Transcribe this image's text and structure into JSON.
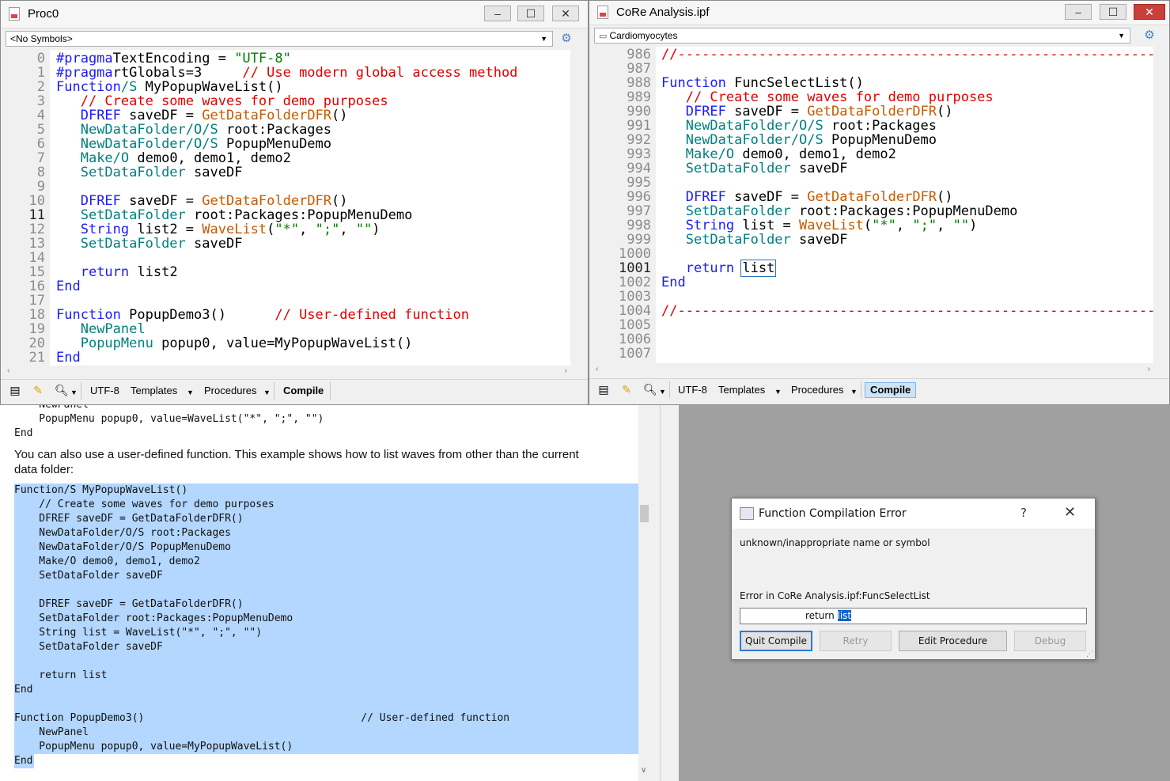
{
  "proc0": {
    "title": "Proc0",
    "symbols": "<No Symbols>",
    "lines": [
      {
        "n": "0",
        "segs": [
          [
            "kw",
            "#pragma"
          ],
          [
            "",
            "TextEncoding = "
          ],
          [
            "st",
            "\"UTF-8\""
          ]
        ]
      },
      {
        "n": "1",
        "segs": [
          [
            "kw",
            "#pragma"
          ],
          [
            "",
            "rtGlobals=3     "
          ],
          [
            "cm",
            "// Use modern global access method"
          ]
        ]
      },
      {
        "n": "2",
        "segs": [
          [
            "kw",
            "Function"
          ],
          [
            "op",
            "/S"
          ],
          [
            "",
            " MyPopupWaveList()"
          ]
        ]
      },
      {
        "n": "3",
        "segs": [
          [
            "",
            "   "
          ],
          [
            "cm",
            "// Create some waves for demo purposes"
          ]
        ]
      },
      {
        "n": "4",
        "segs": [
          [
            "",
            "   "
          ],
          [
            "kw",
            "DFREF"
          ],
          [
            "",
            " saveDF = "
          ],
          [
            "fn",
            "GetDataFolderDFR"
          ],
          [
            "",
            "()"
          ]
        ]
      },
      {
        "n": "5",
        "segs": [
          [
            "",
            "   "
          ],
          [
            "op",
            "NewDataFolder/O/S"
          ],
          [
            "",
            " root:Packages"
          ]
        ]
      },
      {
        "n": "6",
        "segs": [
          [
            "",
            "   "
          ],
          [
            "op",
            "NewDataFolder/O/S"
          ],
          [
            "",
            " PopupMenuDemo"
          ]
        ]
      },
      {
        "n": "7",
        "segs": [
          [
            "",
            "   "
          ],
          [
            "op",
            "Make/O"
          ],
          [
            "",
            " demo0, demo1, demo2"
          ]
        ]
      },
      {
        "n": "8",
        "segs": [
          [
            "",
            "   "
          ],
          [
            "op",
            "SetDataFolder"
          ],
          [
            "",
            " saveDF"
          ]
        ]
      },
      {
        "n": "9",
        "segs": []
      },
      {
        "n": "10",
        "segs": [
          [
            "",
            "   "
          ],
          [
            "kw",
            "DFREF"
          ],
          [
            "",
            " saveDF = "
          ],
          [
            "fn",
            "GetDataFolderDFR"
          ],
          [
            "",
            "()"
          ]
        ]
      },
      {
        "n": "11",
        "cur": true,
        "segs": [
          [
            "",
            "   "
          ],
          [
            "op",
            "SetDataFolder"
          ],
          [
            "",
            " root:Packages:PopupMenuDemo"
          ]
        ]
      },
      {
        "n": "12",
        "segs": [
          [
            "",
            "   "
          ],
          [
            "kw",
            "String"
          ],
          [
            "",
            " list2 = "
          ],
          [
            "fn",
            "WaveList"
          ],
          [
            "",
            "("
          ],
          [
            "st",
            "\"*\""
          ],
          [
            "",
            ", "
          ],
          [
            "st",
            "\";\""
          ],
          [
            "",
            ", "
          ],
          [
            "st",
            "\"\""
          ],
          [
            "",
            ")"
          ]
        ]
      },
      {
        "n": "13",
        "segs": [
          [
            "",
            "   "
          ],
          [
            "op",
            "SetDataFolder"
          ],
          [
            "",
            " saveDF"
          ]
        ]
      },
      {
        "n": "14",
        "segs": []
      },
      {
        "n": "15",
        "segs": [
          [
            "",
            "   "
          ],
          [
            "kw",
            "return"
          ],
          [
            "",
            " list2"
          ]
        ]
      },
      {
        "n": "16",
        "segs": [
          [
            "kw",
            "End"
          ]
        ]
      },
      {
        "n": "17",
        "segs": []
      },
      {
        "n": "18",
        "segs": [
          [
            "kw",
            "Function"
          ],
          [
            "",
            " PopupDemo3()      "
          ],
          [
            "cm",
            "// User-defined function"
          ]
        ]
      },
      {
        "n": "19",
        "segs": [
          [
            "",
            "   "
          ],
          [
            "op",
            "NewPanel"
          ]
        ]
      },
      {
        "n": "20",
        "segs": [
          [
            "",
            "   "
          ],
          [
            "op",
            "PopupMenu"
          ],
          [
            "",
            " popup0, value=MyPopupWaveList()"
          ]
        ]
      },
      {
        "n": "21",
        "segs": [
          [
            "kw",
            "End"
          ]
        ]
      }
    ],
    "toolbar": {
      "encoding": "UTF-8",
      "templates": "Templates",
      "procedures": "Procedures",
      "compile": "Compile"
    }
  },
  "core": {
    "title": "CoRe Analysis.ipf",
    "symbols": "Cardiomyocytes",
    "lines": [
      {
        "n": "986",
        "segs": [
          [
            "cm",
            "//-----------------------------------------------------------------"
          ]
        ]
      },
      {
        "n": "987",
        "segs": []
      },
      {
        "n": "988",
        "segs": [
          [
            "kw",
            "Function"
          ],
          [
            "",
            " FuncSelectList()"
          ]
        ]
      },
      {
        "n": "989",
        "segs": [
          [
            "",
            "   "
          ],
          [
            "cm",
            "// Create some waves for demo purposes"
          ]
        ]
      },
      {
        "n": "990",
        "segs": [
          [
            "",
            "   "
          ],
          [
            "kw",
            "DFREF"
          ],
          [
            "",
            " saveDF = "
          ],
          [
            "fn",
            "GetDataFolderDFR"
          ],
          [
            "",
            "()"
          ]
        ]
      },
      {
        "n": "991",
        "segs": [
          [
            "",
            "   "
          ],
          [
            "op",
            "NewDataFolder/O/S"
          ],
          [
            "",
            " root:Packages"
          ]
        ]
      },
      {
        "n": "992",
        "segs": [
          [
            "",
            "   "
          ],
          [
            "op",
            "NewDataFolder/O/S"
          ],
          [
            "",
            " PopupMenuDemo"
          ]
        ]
      },
      {
        "n": "993",
        "segs": [
          [
            "",
            "   "
          ],
          [
            "op",
            "Make/O"
          ],
          [
            "",
            " demo0, demo1, demo2"
          ]
        ]
      },
      {
        "n": "994",
        "segs": [
          [
            "",
            "   "
          ],
          [
            "op",
            "SetDataFolder"
          ],
          [
            "",
            " saveDF"
          ]
        ]
      },
      {
        "n": "995",
        "segs": []
      },
      {
        "n": "996",
        "segs": [
          [
            "",
            "   "
          ],
          [
            "kw",
            "DFREF"
          ],
          [
            "",
            " saveDF = "
          ],
          [
            "fn",
            "GetDataFolderDFR"
          ],
          [
            "",
            "()"
          ]
        ]
      },
      {
        "n": "997",
        "segs": [
          [
            "",
            "   "
          ],
          [
            "op",
            "SetDataFolder"
          ],
          [
            "",
            " root:Packages:PopupMenuDemo"
          ]
        ]
      },
      {
        "n": "998",
        "segs": [
          [
            "",
            "   "
          ],
          [
            "kw",
            "String"
          ],
          [
            "",
            " list = "
          ],
          [
            "fn",
            "WaveList"
          ],
          [
            "",
            "("
          ],
          [
            "st",
            "\"*\""
          ],
          [
            "",
            ", "
          ],
          [
            "st",
            "\";\""
          ],
          [
            "",
            ", "
          ],
          [
            "st",
            "\"\""
          ],
          [
            "",
            ")"
          ]
        ]
      },
      {
        "n": "999",
        "segs": [
          [
            "",
            "   "
          ],
          [
            "op",
            "SetDataFolder"
          ],
          [
            "",
            " saveDF"
          ]
        ]
      },
      {
        "n": "1000",
        "segs": []
      },
      {
        "n": "1001",
        "cur": true,
        "segs": [
          [
            "",
            "   "
          ],
          [
            "kw",
            "return"
          ],
          [
            "",
            " "
          ],
          [
            "hilite",
            "list"
          ]
        ]
      },
      {
        "n": "1002",
        "segs": [
          [
            "kw",
            "End"
          ]
        ]
      },
      {
        "n": "1003",
        "segs": []
      },
      {
        "n": "1004",
        "segs": [
          [
            "cm",
            "//-----------------------------------------------------------------"
          ]
        ]
      },
      {
        "n": "1005",
        "segs": []
      },
      {
        "n": "1006",
        "segs": []
      },
      {
        "n": "1007",
        "segs": []
      }
    ],
    "toolbar": {
      "encoding": "UTF-8",
      "templates": "Templates",
      "procedures": "Procedures",
      "compile": "Compile"
    }
  },
  "help": {
    "top_lines": [
      "    NewPanel",
      "    PopupMenu popup0, value=WaveList(\"*\", \";\", \"\")",
      "End"
    ],
    "paragraph": "You can also use a user-defined function. This example shows how to list waves from other than the current data folder:",
    "code_lines": [
      "Function/S MyPopupWaveList()",
      "    // Create some waves for demo purposes",
      "    DFREF saveDF = GetDataFolderDFR()",
      "    NewDataFolder/O/S root:Packages",
      "    NewDataFolder/O/S PopupMenuDemo",
      "    Make/O demo0, demo1, demo2",
      "    SetDataFolder saveDF",
      "",
      "    DFREF saveDF = GetDataFolderDFR()",
      "    SetDataFolder root:Packages:PopupMenuDemo",
      "    String list = WaveList(\"*\", \";\", \"\")",
      "    SetDataFolder saveDF",
      "",
      "    return list",
      "End",
      "",
      "Function PopupDemo3()                                   // User-defined function",
      "    NewPanel",
      "    PopupMenu popup0, value=MyPopupWaveList()",
      "End"
    ]
  },
  "dialog": {
    "title": "Function Compilation Error",
    "help_glyph": "?",
    "close_glyph": "✕",
    "message": "unknown/inappropriate name or symbol",
    "error_in": "Error in  CoRe Analysis.ipf:FuncSelectList",
    "code_prefix": "return ",
    "code_selected": "list",
    "buttons": {
      "quit": "Quit Compile",
      "retry": "Retry",
      "edit": "Edit Procedure",
      "debug": "Debug"
    }
  },
  "icons": {
    "minimize": "minimize-icon",
    "maximize": "maximize-icon",
    "close": "close-icon",
    "gear": "gear-icon",
    "notes": "notes-icon",
    "pencil": "pencil-icon",
    "search": "magnifier-icon"
  },
  "colors": {
    "keyword": "#1a1aff",
    "function": "#c65a00",
    "operation": "#007f7f",
    "comment": "#e00000",
    "string": "#008000",
    "selection": "#b3d7ff"
  }
}
